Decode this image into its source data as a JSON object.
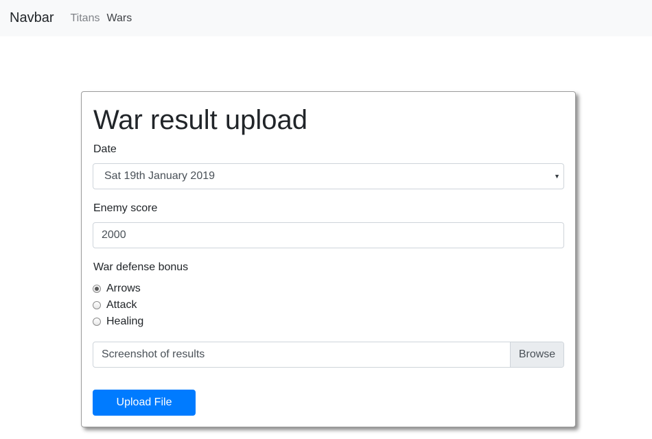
{
  "navbar": {
    "brand": "Navbar",
    "links": [
      {
        "label": "Titans",
        "state": "muted"
      },
      {
        "label": "Wars",
        "state": "active"
      }
    ]
  },
  "form": {
    "title": "War result upload",
    "date": {
      "label": "Date",
      "selected": "Sat 19th January 2019"
    },
    "enemy_score": {
      "label": "Enemy score",
      "value": "2000"
    },
    "defense_bonus": {
      "label": "War defense bonus",
      "options": [
        "Arrows",
        "Attack",
        "Healing"
      ],
      "selected": "Arrows"
    },
    "file": {
      "placeholder": "Screenshot of results",
      "browse_label": "Browse"
    },
    "submit_label": "Upload File"
  },
  "colors": {
    "primary": "#007bff",
    "navbar_bg": "#f8f9fa"
  }
}
